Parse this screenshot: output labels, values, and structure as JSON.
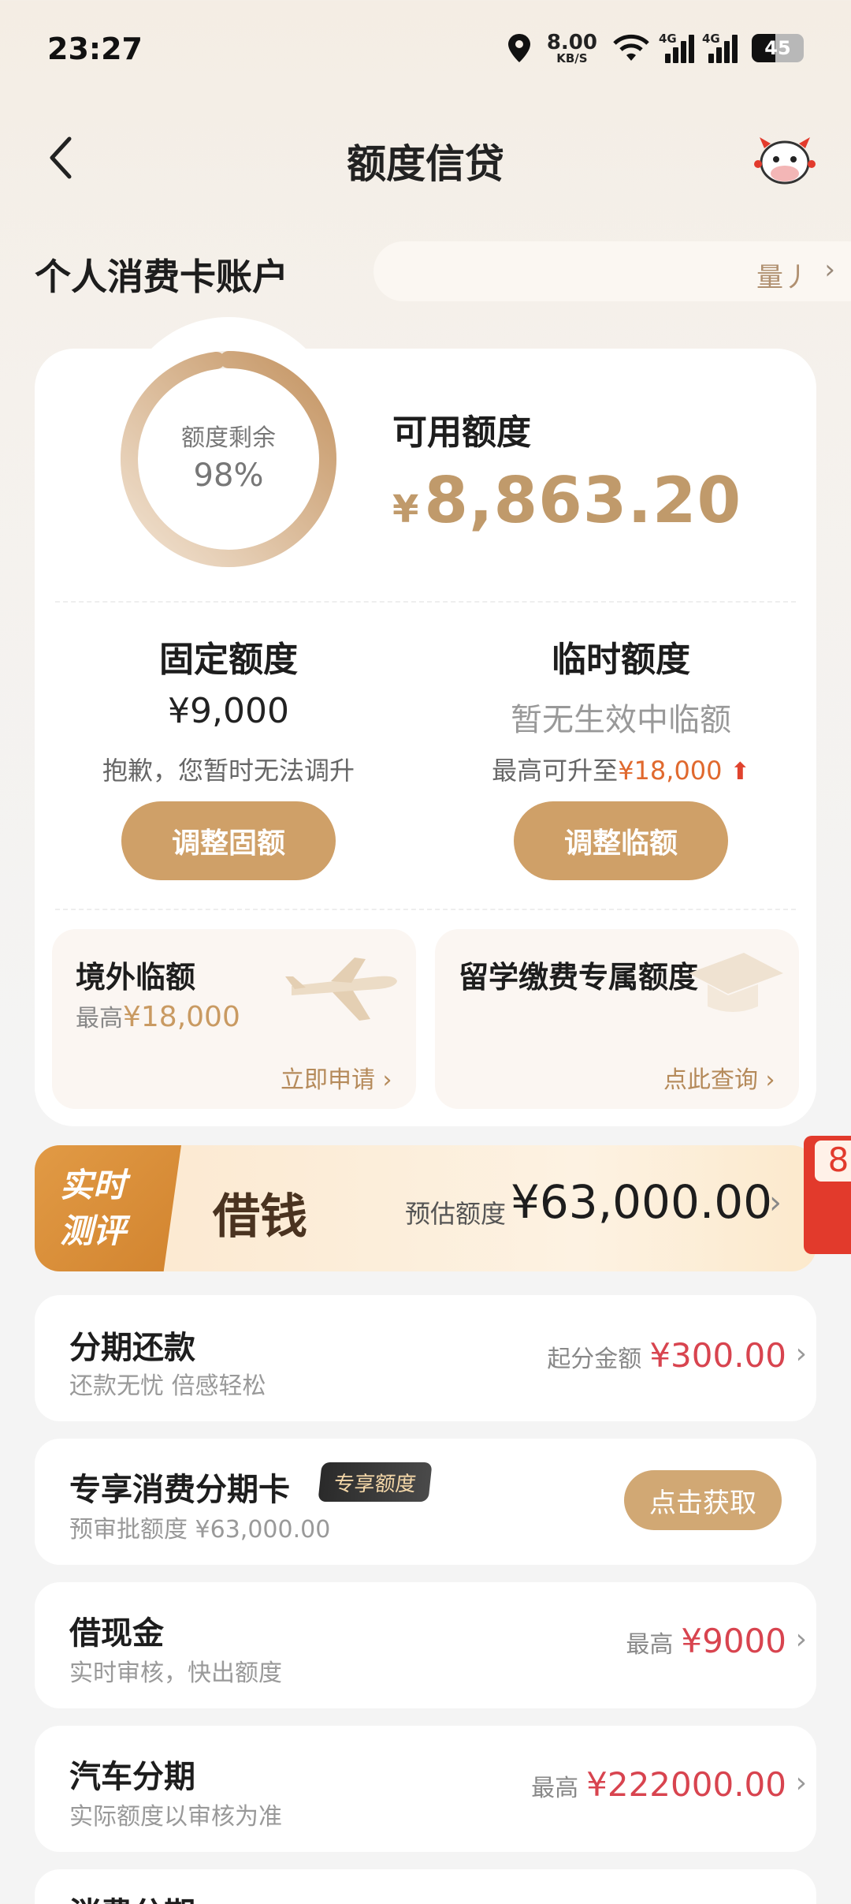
{
  "status_bar": {
    "time": "23:27",
    "net_speed": "8.00",
    "net_unit": "KB/S",
    "net1": "4G",
    "net2": "4G",
    "battery": "45"
  },
  "header": {
    "title": "额度信贷",
    "back_icon": "chevron-left-icon",
    "mascot_icon": "cow-mascot-icon"
  },
  "account": {
    "title": "个人消费卡账户",
    "marquee_text": "量丿"
  },
  "quota": {
    "remaining_label": "额度剩余",
    "remaining_percent": "98%",
    "remaining_fraction": 0.98,
    "available_label": "可用额度",
    "currency": "¥",
    "available_amount": "8,863.20"
  },
  "fixed": {
    "title": "固定额度",
    "value": "¥9,000",
    "note": "抱歉，您暂时无法调升",
    "button": "调整固额"
  },
  "temporary": {
    "title": "临时额度",
    "value": "暂无生效中临额",
    "note_prefix": "最高可升至",
    "note_amount": "¥18,000",
    "button": "调整临额"
  },
  "overseas": {
    "title": "境外临额",
    "note_prefix": "最高",
    "note_amount": "¥18,000",
    "link": "立即申请"
  },
  "study_abroad": {
    "title": "留学缴费专属额度",
    "link": "点此查询"
  },
  "loan_banner": {
    "tag_line1": "实时",
    "tag_line2": "测评",
    "title": "借钱",
    "estimate_label": "预估额度",
    "estimate_value": "¥63,000.00",
    "badge_text": "8"
  },
  "list": {
    "installment": {
      "title": "分期还款",
      "subtitle": "还款无忧 倍感轻松",
      "right_label": "起分金额",
      "right_value": "¥300.00"
    },
    "exclusive_card": {
      "title": "专享消费分期卡",
      "badge": "专享额度",
      "subtitle": "预审批额度 ¥63,000.00",
      "button": "点击获取"
    },
    "cash": {
      "title": "借现金",
      "subtitle": "实时审核，快出额度",
      "right_label": "最高",
      "right_value": "¥9000"
    },
    "auto": {
      "title": "汽车分期",
      "subtitle": "实际额度以审核为准",
      "right_label": "最高",
      "right_value": "¥222000.00"
    },
    "consumer": {
      "title": "消费分期"
    }
  },
  "colors": {
    "gold": "#c09a6b",
    "button_gold": "#cfa068",
    "red_value": "#d8444f",
    "orange_highlight": "#e0692e"
  }
}
